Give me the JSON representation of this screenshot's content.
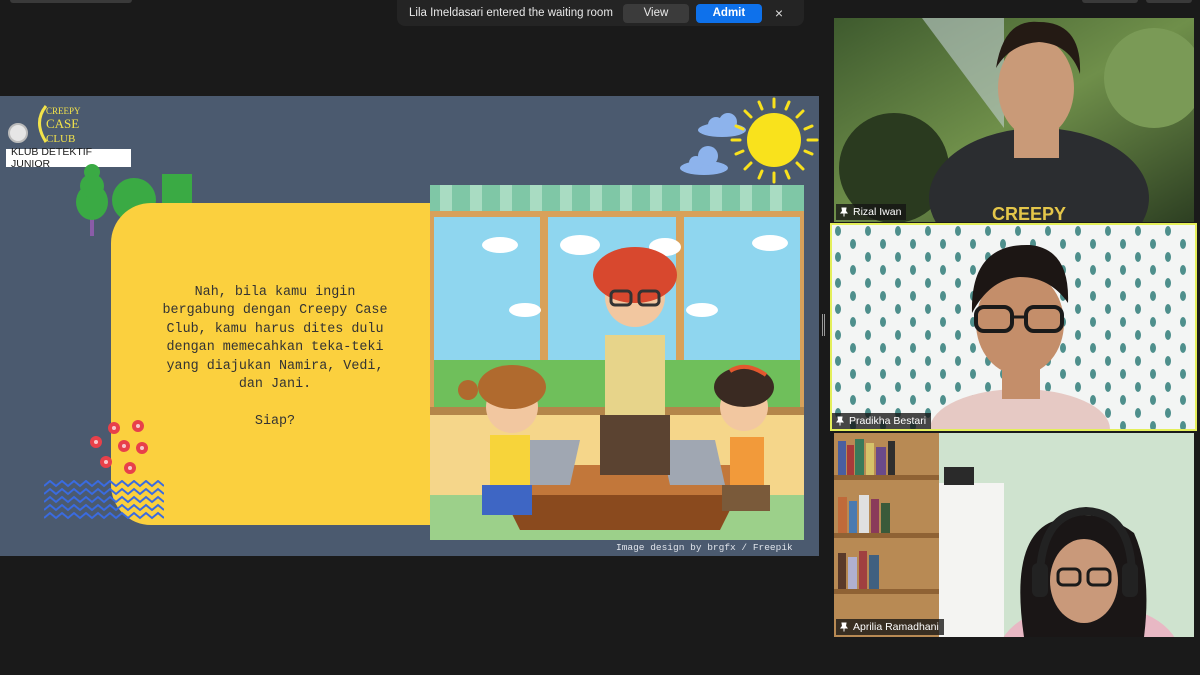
{
  "notification": {
    "message": "Lila Imeldasari entered the waiting room",
    "view_label": "View",
    "admit_label": "Admit",
    "close_icon": "×"
  },
  "slide": {
    "logo_text": [
      "CREEPY",
      "CASE",
      "CLUB"
    ],
    "club_label": "KLUB DETEKTIF JUNIOR",
    "paragraph_lines": [
      "Nah, bila kamu ingin",
      "bergabung dengan Creepy Case",
      "Club, kamu harus dites dulu",
      "dengan memecahkan teka-teki",
      "yang diajukan Namira, Vedi,",
      "dan Jani."
    ],
    "question": "Siap?",
    "credit": "Image design by brgfx / Freepik"
  },
  "participants": [
    {
      "name": "Rizal Iwan",
      "shirt_text": "CREEPY",
      "active": false
    },
    {
      "name": "Pradikha Bestari",
      "active": true
    },
    {
      "name": "Aprilia Ramadhani",
      "active": false
    }
  ],
  "colors": {
    "admit_blue": "#0e71eb",
    "active_speaker": "#e4ef5a",
    "slide_bg": "#4b5a6f",
    "card_yellow": "#fbd03e"
  }
}
